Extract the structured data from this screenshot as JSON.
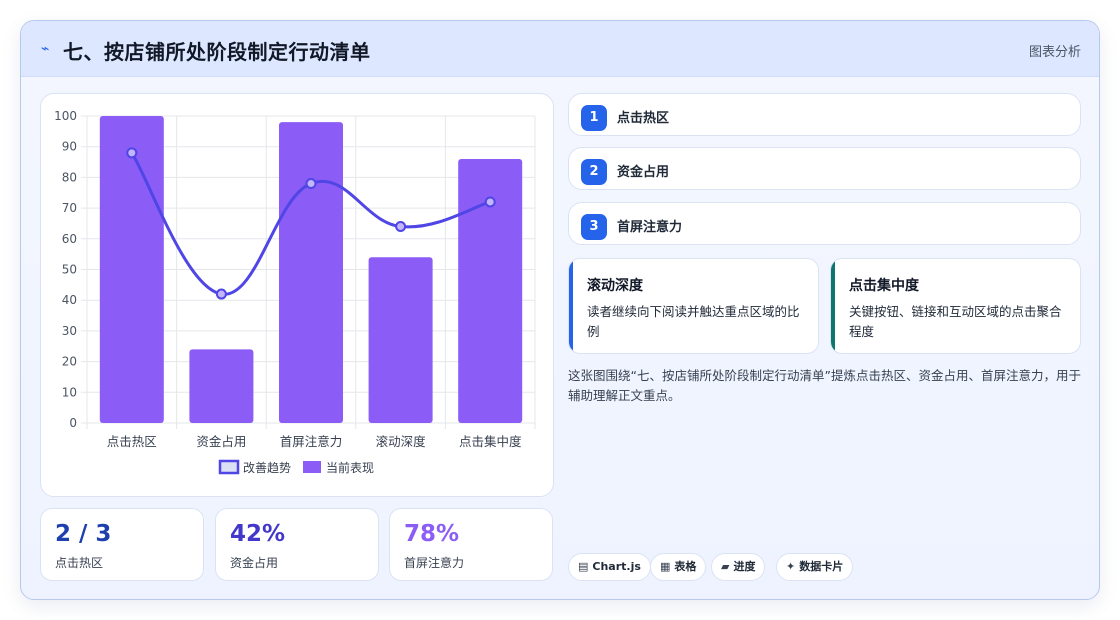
{
  "header": {
    "title": "七、按店铺所处阶段制定行动清单",
    "tag": "图表分析"
  },
  "chart_data": {
    "type": "bar",
    "categories": [
      "点击热区",
      "资金占用",
      "首屏注意力",
      "滚动深度",
      "点击集中度"
    ],
    "series": [
      {
        "name": "当前表现",
        "type": "bar",
        "values": [
          100,
          24,
          98,
          54,
          86
        ]
      },
      {
        "name": "改善趋势",
        "type": "line",
        "values": [
          88,
          42,
          78,
          64,
          72
        ]
      }
    ],
    "ylim": [
      0,
      100
    ],
    "yticks": [
      0,
      10,
      20,
      30,
      40,
      50,
      60,
      70,
      80,
      90,
      100
    ],
    "legend": [
      "改善趋势",
      "当前表现"
    ],
    "legend_position": "bottom",
    "grid": true,
    "colors": {
      "bar": "#8b5cf6",
      "line": "#4f46e5"
    }
  },
  "stats": [
    {
      "value": "2 / 3",
      "label": "点击热区",
      "color": "#1e40af"
    },
    {
      "value": "42%",
      "label": "资金占用",
      "color": "#4338ca"
    },
    {
      "value": "78%",
      "label": "首屏注意力",
      "color": "#8b5cf6"
    }
  ],
  "pills": [
    {
      "num": "1",
      "text": "点击热区"
    },
    {
      "num": "2",
      "text": "资金占用"
    },
    {
      "num": "3",
      "text": "首屏注意力"
    }
  ],
  "metrics": [
    {
      "title": "滚动深度",
      "desc": "读者继续向下阅读并触达重点区域的比例",
      "color": "#2563eb"
    },
    {
      "title": "点击集中度",
      "desc": "关键按钮、链接和互动区域的点击聚合程度",
      "color": "#0f766e"
    }
  ],
  "description": "这张图围绕“七、按店铺所处阶段制定行动清单”提炼点击热区、资金占用、首屏注意力，用于辅助理解正文重点。",
  "chips": [
    {
      "icon": "chart-icon",
      "label": "Chart.js"
    },
    {
      "icon": "table-icon",
      "label": "表格"
    },
    {
      "icon": "progress-icon",
      "label": "进度"
    },
    {
      "icon": "sparkle-icon",
      "label": "数据卡片"
    }
  ]
}
